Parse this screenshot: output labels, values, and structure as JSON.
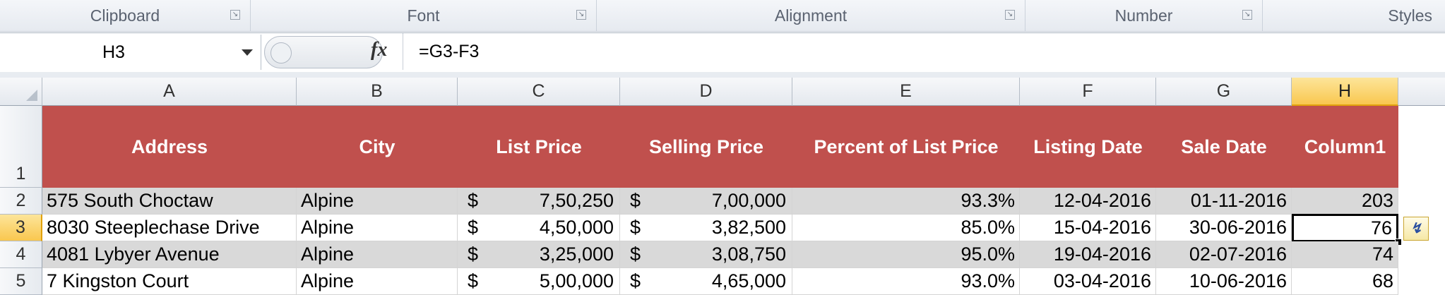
{
  "ribbon": {
    "groups": [
      {
        "label": "Clipboard"
      },
      {
        "label": "Font"
      },
      {
        "label": "Alignment"
      },
      {
        "label": "Number"
      },
      {
        "label": "Styles"
      }
    ]
  },
  "formula_bar": {
    "name_box": "H3",
    "fx_icon": "fx",
    "formula": "=G3-F3"
  },
  "columns": [
    "A",
    "B",
    "C",
    "D",
    "E",
    "F",
    "G",
    "H"
  ],
  "selected_column": "H",
  "rows": [
    "1",
    "2",
    "3",
    "4",
    "5"
  ],
  "selected_row": "3",
  "table": {
    "headers": [
      "Address",
      "City",
      "List Price",
      "Selling Price",
      "Percent of List Price",
      "Listing Date",
      "Sale Date",
      "Column1"
    ],
    "currency_symbol": "$",
    "data": [
      {
        "address": "575 South Choctaw",
        "city": "Alpine",
        "list_price": "7,50,250",
        "selling_price": "7,00,000",
        "percent": "93.3%",
        "listing_date": "12-04-2016",
        "sale_date": "01-11-2016",
        "column1": "203"
      },
      {
        "address": "8030 Steeplechase Drive",
        "city": "Alpine",
        "list_price": "4,50,000",
        "selling_price": "3,82,500",
        "percent": "85.0%",
        "listing_date": "15-04-2016",
        "sale_date": "30-06-2016",
        "column1": "76"
      },
      {
        "address": "4081 Lybyer Avenue",
        "city": "Alpine",
        "list_price": "3,25,000",
        "selling_price": "3,08,750",
        "percent": "95.0%",
        "listing_date": "19-04-2016",
        "sale_date": "02-07-2016",
        "column1": "74"
      },
      {
        "address": "7 Kingston Court",
        "city": "Alpine",
        "list_price": "5,00,000",
        "selling_price": "4,65,000",
        "percent": "93.0%",
        "listing_date": "03-04-2016",
        "sale_date": "10-06-2016",
        "column1": "68"
      }
    ]
  },
  "colors": {
    "header_fill": "#c0504d",
    "band_fill": "#d9d9d9",
    "selection_highlight": "#f9c74f"
  }
}
